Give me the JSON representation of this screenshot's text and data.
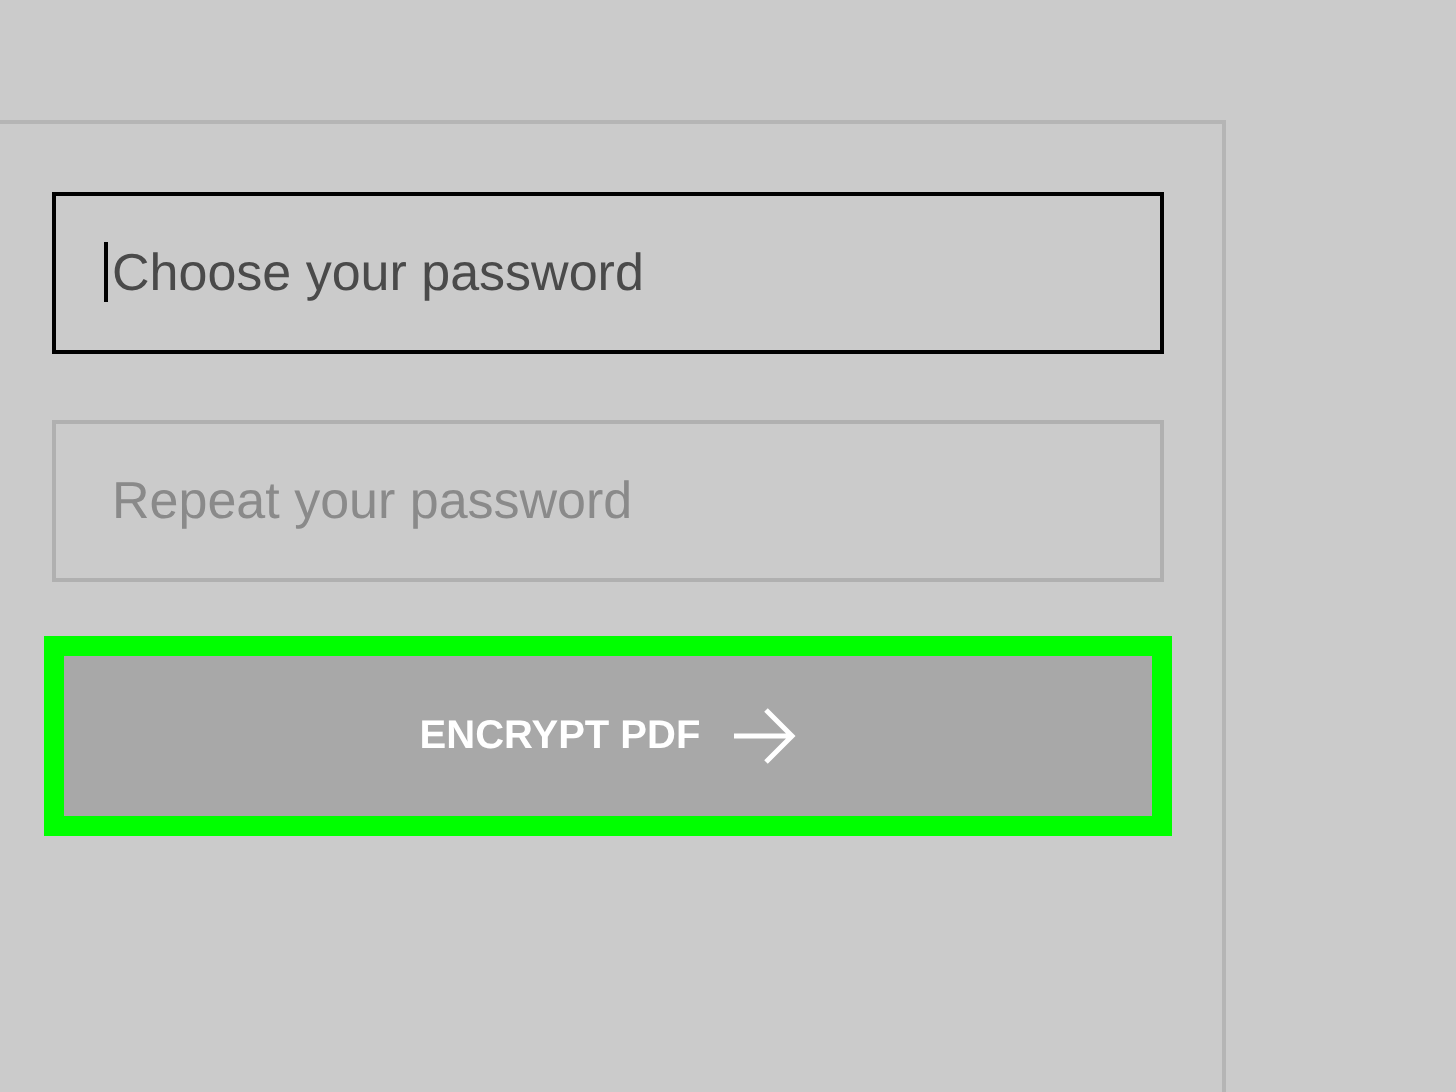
{
  "fields": [
    {
      "placeholder": "Choose your password",
      "focused": true
    },
    {
      "placeholder": "Repeat your password",
      "focused": false
    }
  ],
  "button": {
    "label": "ENCRYPT PDF",
    "highlighted": true
  }
}
